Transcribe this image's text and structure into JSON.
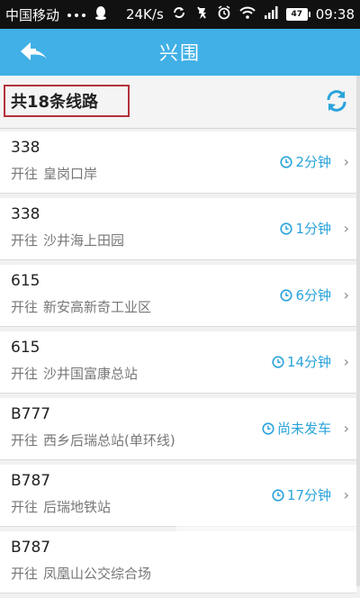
{
  "status_bar": {
    "carrier": "中国移动",
    "speed": "24K/s",
    "battery": "47",
    "time": "09:38"
  },
  "header": {
    "title": "兴围"
  },
  "summary": {
    "route_count": "共18条线路"
  },
  "routes": [
    {
      "route": "338",
      "prefix": "开往",
      "destination": "皇岗口岸",
      "eta": "2分钟"
    },
    {
      "route": "338",
      "prefix": "开往",
      "destination": "沙井海上田园",
      "eta": "1分钟"
    },
    {
      "route": "615",
      "prefix": "开往",
      "destination": "新安高新奇工业区",
      "eta": "6分钟"
    },
    {
      "route": "615",
      "prefix": "开往",
      "destination": "沙井国富康总站",
      "eta": "14分钟"
    },
    {
      "route": "B777",
      "prefix": "开往",
      "destination": "西乡后瑞总站(单环线)",
      "eta": "尚未发车"
    },
    {
      "route": "B787",
      "prefix": "开往",
      "destination": "后瑞地铁站",
      "eta": "17分钟"
    },
    {
      "route": "B787",
      "prefix": "开往",
      "destination": "凤凰山公交综合场",
      "eta": ""
    }
  ],
  "colors": {
    "header_bg": "#40b0e6",
    "eta": "#2aa3db",
    "highlight_border": "#b3323a"
  }
}
